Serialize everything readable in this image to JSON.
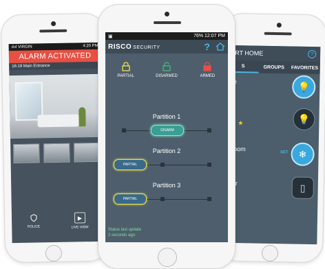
{
  "left_phone": {
    "carrier": "ılııl VIRGIN",
    "time": "4:20 PM",
    "alarm_banner": "ALARM ACTIVATED",
    "event_line": "16:19 Main Entrance",
    "actions": [
      {
        "label": "POLICE",
        "icon": "police-icon"
      },
      {
        "label": "LIVE VIEW",
        "icon": "play-icon"
      }
    ]
  },
  "center_phone": {
    "status_time": "12:07 PM",
    "status_battery": "76%",
    "brand": "RISCO",
    "brand_sub": "SECURITY",
    "modes": [
      {
        "label": "PARTIAL",
        "color": "#f0e24b"
      },
      {
        "label": "DISARMED",
        "color": "#39c07a"
      },
      {
        "label": "ARMED",
        "color": "#e94f43"
      }
    ],
    "partitions": [
      {
        "title": "Partition 1",
        "state_label": "DISARM",
        "state": "disarmed"
      },
      {
        "title": "Partition 2",
        "state_label": "PARTIAL",
        "state": "partial"
      },
      {
        "title": "Partition 3",
        "state_label": "PARTIAL",
        "state": "partial"
      }
    ],
    "status_footer_1": "Status last update",
    "status_footer_2": "2 seconds ago"
  },
  "right_phone": {
    "header_title": "ART HOME",
    "tabs": [
      "S",
      "GROUPS",
      "FAVORITES"
    ],
    "rows": [
      {
        "label": "ce",
        "icon": "bulb-icon",
        "on": true
      },
      {
        "label": "n",
        "icon": "bulb-icon",
        "on": false,
        "favorite": true
      },
      {
        "label": "Room",
        "icon": "snowflake-icon",
        "on": true,
        "set_label": "SET"
      },
      {
        "label": "oor",
        "icon": "door-icon",
        "on": false
      }
    ],
    "footer": "er"
  },
  "colors": {
    "accent_blue": "#4bb6e8",
    "alarm_red": "#e94f43",
    "disarm_green": "#39c07a",
    "partial_yellow": "#f0e24b"
  }
}
